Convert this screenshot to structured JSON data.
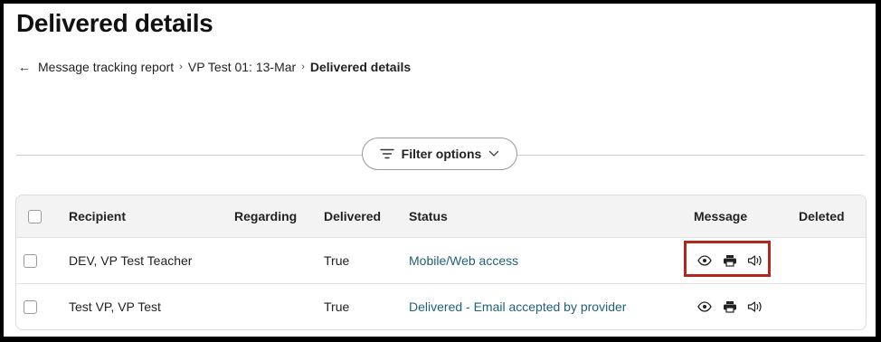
{
  "page": {
    "title": "Delivered details",
    "breadcrumb": {
      "back_arrow": "←",
      "items": [
        "Message tracking report",
        "VP Test 01: 13-Mar",
        "Delivered details"
      ],
      "separator": "›"
    }
  },
  "filter": {
    "label": "Filter options",
    "icons": [
      "filter-lines-icon",
      "chevron-down-icon"
    ]
  },
  "table": {
    "headers": [
      "Recipient",
      "Regarding",
      "Delivered",
      "Status",
      "Message",
      "Deleted"
    ],
    "rows": [
      {
        "recipient": "DEV, VP Test Teacher",
        "regarding": "",
        "delivered": "True",
        "status": "Mobile/Web access",
        "deleted": ""
      },
      {
        "recipient": "Test VP, VP Test",
        "regarding": "",
        "delivered": "True",
        "status": "Delivered - Email accepted by provider",
        "deleted": ""
      }
    ],
    "message_icons": [
      "eye-icon",
      "printer-icon",
      "speaker-icon"
    ]
  },
  "colors": {
    "link": "#1f5f7a",
    "highlight": "#b3261e",
    "header_bg": "#f3f3f3"
  }
}
